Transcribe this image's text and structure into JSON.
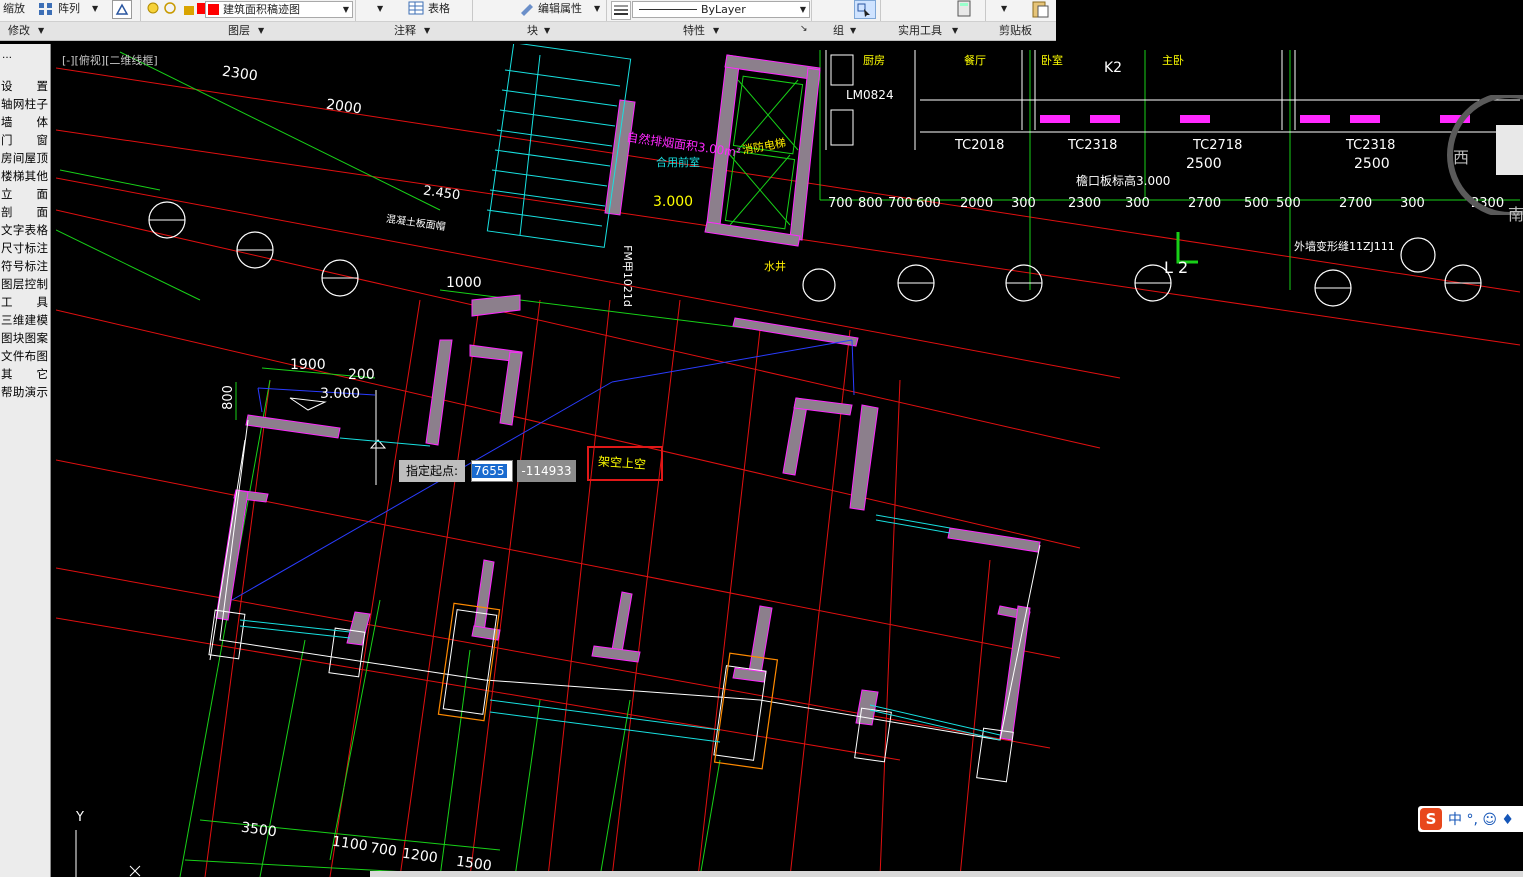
{
  "ribbon": {
    "row1": {
      "scale_label": "缩放",
      "array_label": "阵列",
      "layer_name": "建筑面积稿迹图",
      "table_label": "表格",
      "edit_attr_label": "编辑属性",
      "linetype_value": "ByLayer"
    },
    "panels": {
      "modify": "修改",
      "layer": "图层",
      "annotation": "注释",
      "block": "块",
      "properties": "特性",
      "group": "组",
      "utilities": "实用工具",
      "clipboard": "剪贴板"
    },
    "layer_color": "#ff0000"
  },
  "left_panel": {
    "items": [
      "设　置",
      "轴网柱子",
      "墙　体",
      "门　窗",
      "房间屋顶",
      "楼梯其他",
      "立　面",
      "剖　面",
      "文字表格",
      "尺寸标注",
      "符号标注",
      "图层控制",
      "工　具",
      "三维建模",
      "图块图案",
      "文件布图",
      "其　它",
      "帮助演示"
    ]
  },
  "viewport": {
    "label": "[-][俯视][二维线框]",
    "background": "#000000"
  },
  "cursor_input": {
    "prompt": "指定起点:",
    "x_value": "7655",
    "y_value": "-114933"
  },
  "annotation_text": "架空上空",
  "cad_text": {
    "stair_label": "合用前室",
    "elevator_label": "消防电梯",
    "elevation_1": "3.000",
    "elevation_2": "2.450",
    "fire_area": "自然排烟面积3.00m²",
    "fire_lift": "消防电梯",
    "fire_door": "FM甲1021d",
    "water_well": "水井",
    "window_1": "TC2018",
    "window_2": "TC2318",
    "window_3": "TC2718",
    "window_4": "TC2318",
    "door_1": "LM0824",
    "room_1": "厨房",
    "room_2": "餐厅",
    "room_3": "卧室",
    "room_4": "主卧",
    "k2": "K2",
    "dims_top": [
      "700",
      "800",
      "700",
      "600",
      "2000",
      "300",
      "2300",
      "300",
      "2700",
      "500",
      "500",
      "2700",
      "300",
      "2300"
    ],
    "dims_bottom": [
      "3500",
      "1100",
      "700",
      "1200",
      "1500"
    ],
    "dim_1900": "1900",
    "dim_200": "200",
    "dim_800": "800",
    "dim_1000": "1000",
    "dim_2300": "2300",
    "dim_2000": "2000",
    "dim_2500": "2500",
    "compass_west": "西",
    "compass_south": "南",
    "axis_y": "Y",
    "sec_l": "L 2",
    "wall_note": "外墙变形缝11ZJ111",
    "ledge_note": "檐口板标高3.000",
    "roof_note": "混凝土板面帽"
  },
  "ime": {
    "logo": "S",
    "text": "中 °, ☺ ♦"
  }
}
